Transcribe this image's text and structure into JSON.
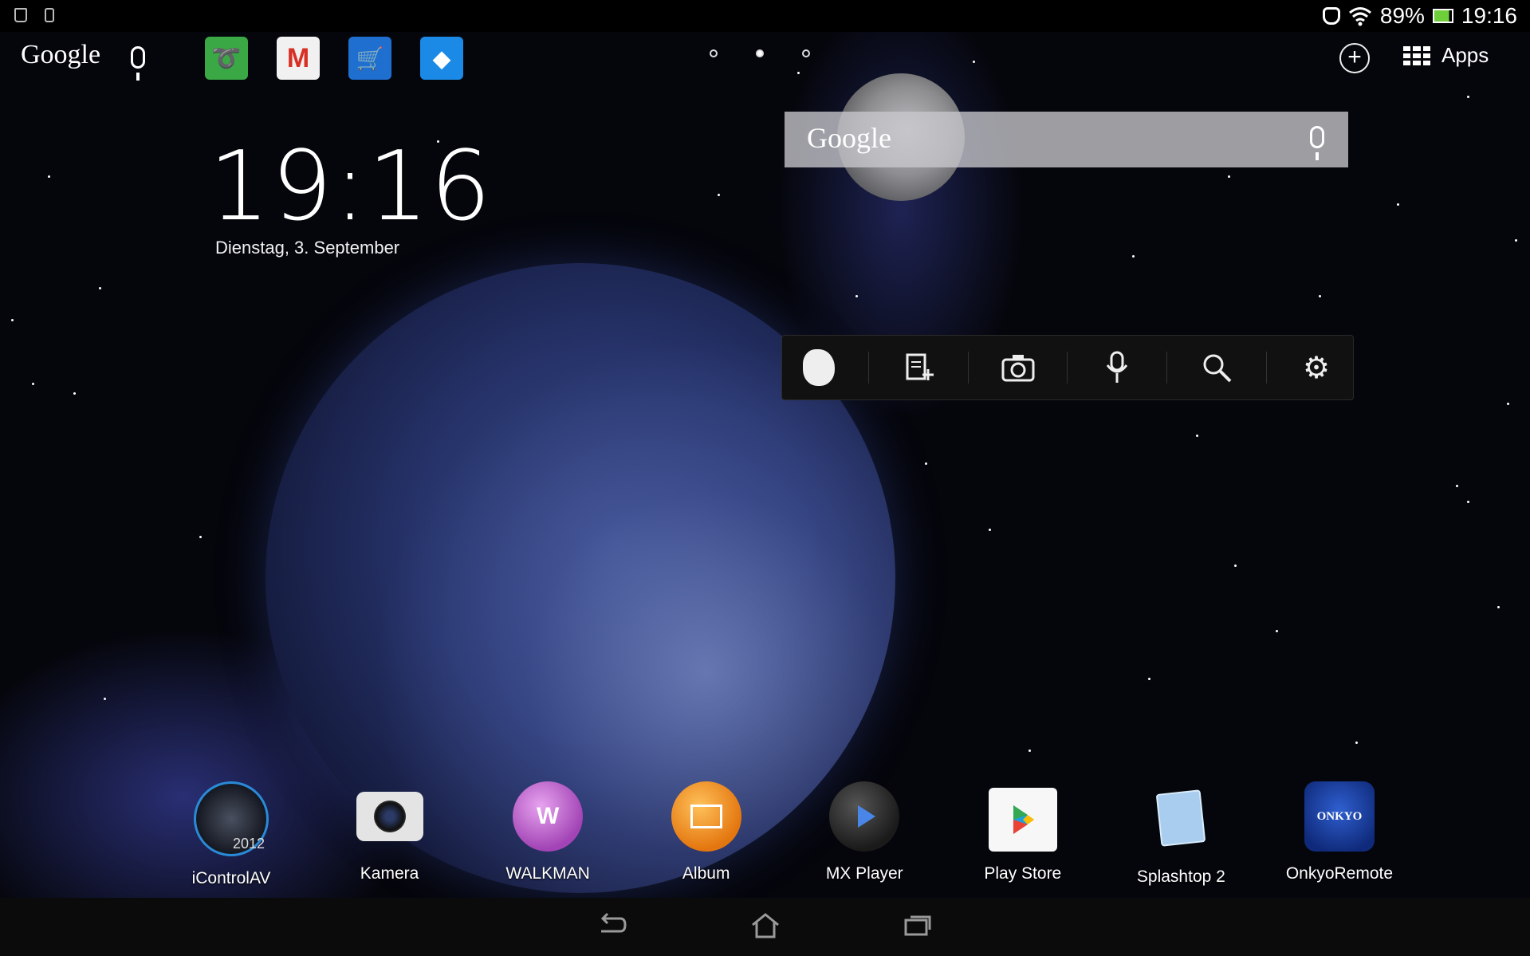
{
  "status_bar": {
    "battery_percent": "89%",
    "time": "19:16"
  },
  "top_bar": {
    "google_label": "Google",
    "shortcuts": [
      {
        "name": "Dolphin",
        "icon": "dolphin-icon",
        "color": "#3aa845"
      },
      {
        "name": "Gmail",
        "icon": "gmail-icon",
        "color": "#e8e8e8"
      },
      {
        "name": "Amazon",
        "icon": "amazon-cart-icon",
        "color": "#1f6fd1"
      },
      {
        "name": "Dropbox",
        "icon": "dropbox-icon",
        "color": "#1b8ae6"
      }
    ],
    "pages": 3,
    "active_page": 2,
    "apps_label": "Apps"
  },
  "clock_widget": {
    "time": "19:16",
    "date": "Dienstag, 3. September"
  },
  "search_widget": {
    "label": "Google"
  },
  "evernote_widget": {
    "items": [
      {
        "icon": "evernote-elephant-icon"
      },
      {
        "icon": "new-note-icon"
      },
      {
        "icon": "camera-icon"
      },
      {
        "icon": "voice-note-icon"
      },
      {
        "icon": "search-icon"
      },
      {
        "icon": "settings-gear-icon"
      }
    ]
  },
  "dock": {
    "apps": [
      {
        "label": "iControlAV",
        "icon": "icontrolav-icon",
        "color": "#1a1f2e",
        "badge": "2012"
      },
      {
        "label": "Kamera",
        "icon": "camera-app-icon",
        "color": "#d9d9d9"
      },
      {
        "label": "WALKMAN",
        "icon": "walkman-icon",
        "color": "#b35cc2"
      },
      {
        "label": "Album",
        "icon": "album-icon",
        "color": "#f08a1c"
      },
      {
        "label": "MX Player",
        "icon": "mx-player-icon",
        "color": "#2a2a2a"
      },
      {
        "label": "Play Store",
        "icon": "play-store-icon",
        "color": "#f5f5f5"
      },
      {
        "label": "Splashtop 2",
        "icon": "splashtop-icon",
        "color": "#9fc6ea"
      },
      {
        "label": "OnkyoRemote",
        "icon": "onkyo-icon",
        "color": "#1d3f9c",
        "badge": "ONKYO"
      }
    ]
  },
  "nav_bar": {
    "back_icon": "back-icon",
    "home_icon": "home-icon",
    "recents_icon": "recent-apps-icon"
  }
}
